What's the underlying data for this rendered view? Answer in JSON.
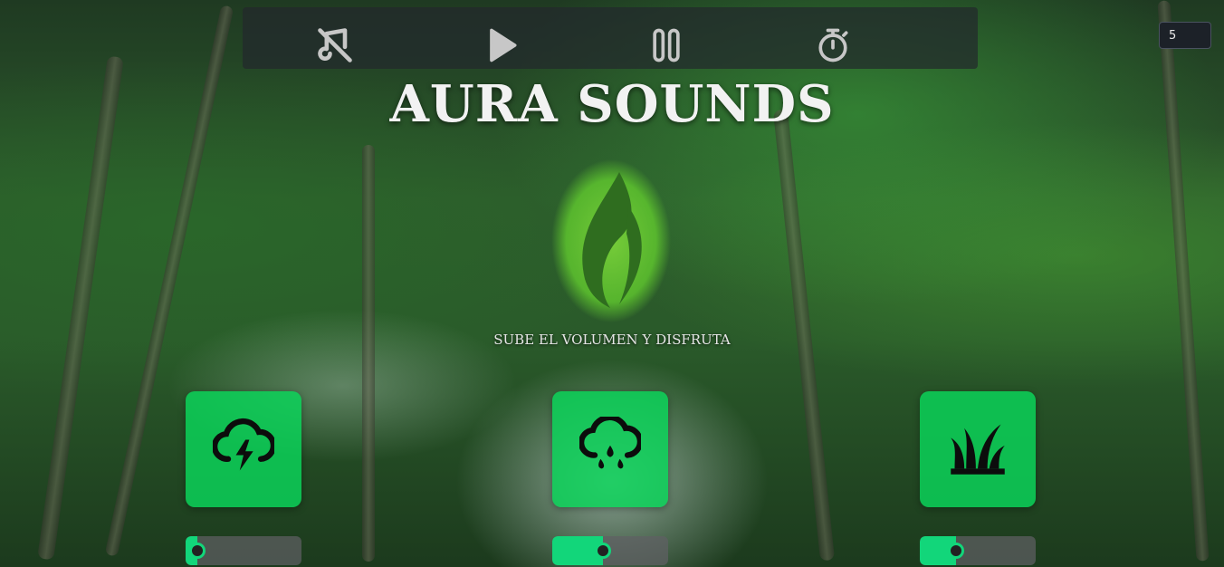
{
  "toolbar": {
    "icons": [
      "music-off-icon",
      "play-icon",
      "pause-icon",
      "stopwatch-icon"
    ],
    "timer_value": "5"
  },
  "header": {
    "title": "AURA SOUNDS",
    "subtitle": "SUBE EL VOLUMEN Y DISFRUTA"
  },
  "sounds": [
    {
      "icon": "thunderstorm-icon",
      "volume": 0.0
    },
    {
      "icon": "rain-icon",
      "volume": 0.42
    },
    {
      "icon": "grass-icon",
      "volume": 0.26
    }
  ],
  "colors": {
    "accent": "#12d67a",
    "card": "#0ad75a",
    "toolbar_bg": "#23282d"
  }
}
